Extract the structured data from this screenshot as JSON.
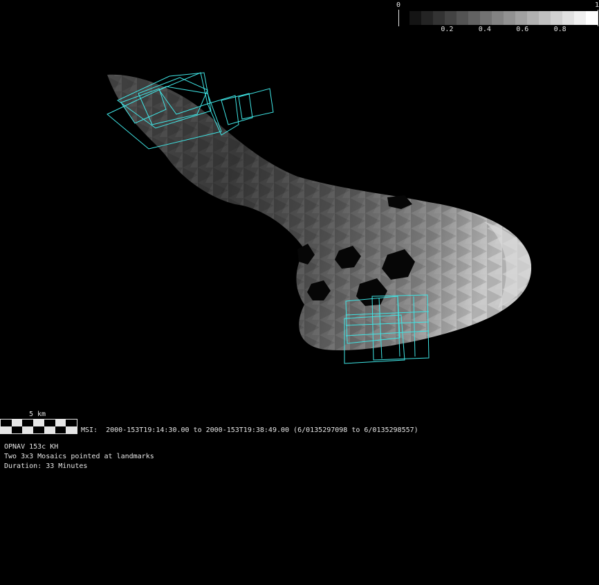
{
  "colorbar": {
    "min_label": "0",
    "max_label": "1",
    "ticks": [
      "0.2",
      "0.4",
      "0.6",
      "0.8"
    ],
    "tick_values": [
      0.2,
      0.4,
      0.6,
      0.8
    ],
    "steps": 16
  },
  "scale_bar": {
    "label": "5 km",
    "segments": 7
  },
  "msi_line": "MSI:  2000-153T19:14:30.00 to 2000-153T19:38:49.00 (6/0135297098 to 6/0135298557)",
  "caption": {
    "line1": "OPNAV 153c KH",
    "line2": "Two 3x3 Mosaics pointed at landmarks",
    "line3": "Duration: 33 Minutes"
  },
  "colors": {
    "background": "#000000",
    "footprint": "#3fe6e6",
    "text": "#e6e6e6"
  }
}
